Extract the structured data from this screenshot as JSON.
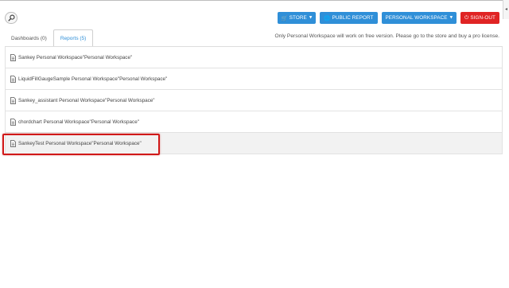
{
  "toolbar": {
    "store_label": "STORE",
    "public_report_label": "PUBLIC REPORT",
    "workspace_label": "PERSONAL WORKSPACE",
    "signout_label": "SIGN-OUT"
  },
  "tabs": [
    {
      "label": "Dashboards (0)",
      "active": false
    },
    {
      "label": "Reports (5)",
      "active": true
    }
  ],
  "notice": "Only Personal Workspace will work on free version. Please go to the store and buy a pro license.",
  "reports": [
    {
      "label": "Sankey Personal Workspace\"Personal Workspace\""
    },
    {
      "label": "LiquidFillGaugeSample Personal Workspace\"Personal Workspace\""
    },
    {
      "label": "Sankey_assistant Personal Workspace\"Personal Workspace\""
    },
    {
      "label": "chordchart Personal Workspace\"Personal Workspace\""
    },
    {
      "label": "SankeyTest Personal Workspace\"Personal Workspace\"",
      "highlighted": true
    }
  ],
  "colors": {
    "primary": "#2f8fd8",
    "danger": "#e02424",
    "highlight_border": "#d01818"
  }
}
